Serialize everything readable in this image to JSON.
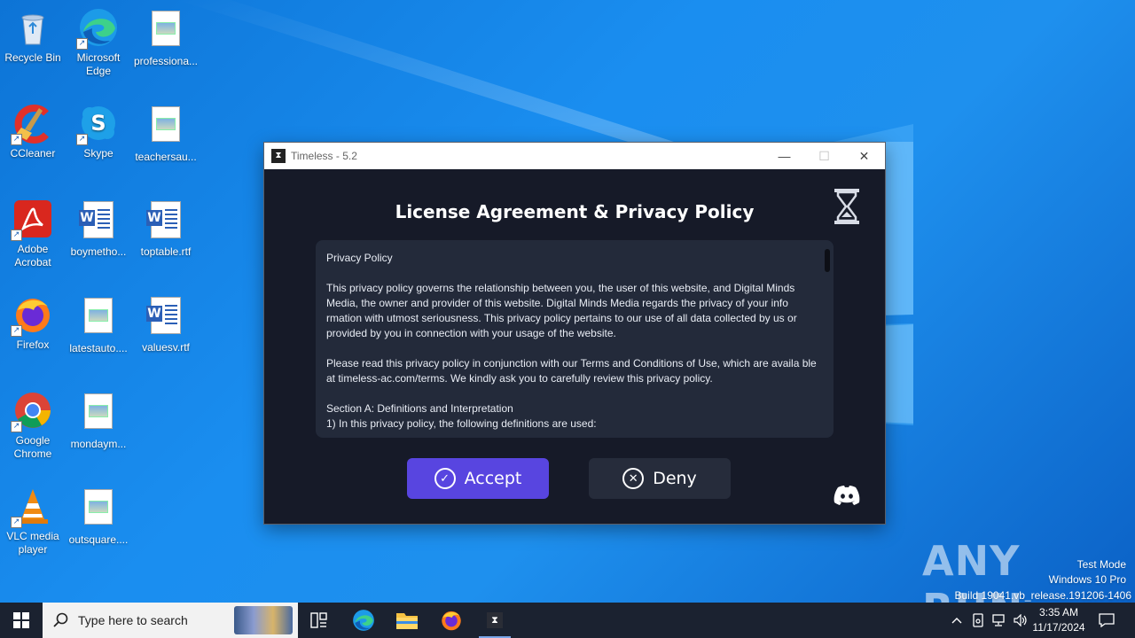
{
  "desktop": {
    "icons": [
      {
        "label": "Recycle Bin"
      },
      {
        "label": "Microsoft Edge"
      },
      {
        "label": "professiona..."
      },
      {
        "label": "CCleaner"
      },
      {
        "label": "Skype"
      },
      {
        "label": "teachersau..."
      },
      {
        "label": "Adobe Acrobat"
      },
      {
        "label": "boymetho..."
      },
      {
        "label": "toptable.rtf"
      },
      {
        "label": "Firefox"
      },
      {
        "label": "latestauto...."
      },
      {
        "label": "valuesv.rtf"
      },
      {
        "label": "Google Chrome"
      },
      {
        "label": "mondaym..."
      },
      {
        "label": "VLC media player"
      },
      {
        "label": "outsquare...."
      }
    ]
  },
  "window": {
    "title": "Timeless - 5.2",
    "minimize_glyph": "—",
    "maximize_glyph": "☐",
    "close_glyph": "✕",
    "heading": "License Agreement &  Privacy Policy",
    "policy": {
      "title": "Privacy Policy",
      "para1": "This privacy policy governs the relationship between you, the user of this website, and Digital Minds Media, the owner and provider of this website. Digital Minds Media regards the privacy of your info rmation with utmost seriousness. This privacy policy pertains to our use of all data collected by us or provided by you in connection with your usage of the website.",
      "para2": "Please read this privacy policy in conjunction with our Terms and Conditions of Use, which are availa ble at timeless-ac.com/terms. We kindly ask you to carefully review this privacy policy.",
      "section": "Section A: Definitions and Interpretation",
      "item1": "1) In this privacy policy, the following definitions are used:"
    },
    "accept_label": "Accept",
    "deny_label": "Deny",
    "colors": {
      "accept": "#5845e0",
      "deny": "#262c3b",
      "bg": "#161a28",
      "panel": "#232a3a"
    }
  },
  "watermark": {
    "brand": "ANY RUN",
    "line1": "Test Mode",
    "line2": "Windows 10 Pro",
    "line3": "Build 19041.vb_release.191206-1406"
  },
  "taskbar": {
    "search_placeholder": "Type here to search",
    "time": "3:35 AM",
    "date": "11/17/2024"
  }
}
